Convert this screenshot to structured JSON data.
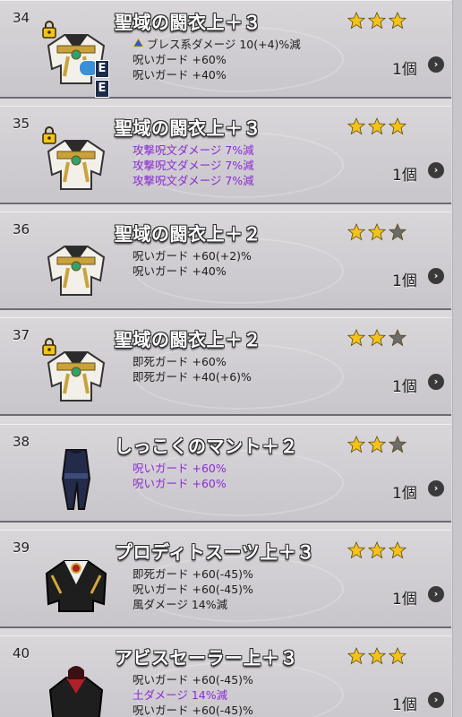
{
  "colors": {
    "gold_star": "#f5c21a",
    "gray_star": "#6c6c6c",
    "purple": "#8a2bd4"
  },
  "items": [
    {
      "num": "34",
      "name": "聖域の闘衣上＋３",
      "stars": 3,
      "locked": true,
      "equipped": true,
      "icon": "holy-robe-icon",
      "lines": [
        {
          "pre": "breath-icon",
          "text": "ブレス系ダメージ 10(+4)%減",
          "purple": false
        },
        {
          "text": "呪いガード +60%",
          "purple": false
        },
        {
          "text": "呪いガード +40%",
          "purple": false
        }
      ],
      "count": "1個"
    },
    {
      "num": "35",
      "name": "聖域の闘衣上＋３",
      "stars": 3,
      "locked": true,
      "equipped": false,
      "icon": "holy-robe-icon",
      "lines": [
        {
          "text": "攻撃呪文ダメージ 7%減",
          "purple": true
        },
        {
          "text": "攻撃呪文ダメージ 7%減",
          "purple": true
        },
        {
          "text": "攻撃呪文ダメージ 7%減",
          "purple": true
        }
      ],
      "count": "1個"
    },
    {
      "num": "36",
      "name": "聖域の闘衣上＋２",
      "stars": 2,
      "locked": false,
      "equipped": false,
      "icon": "holy-robe-icon",
      "lines": [
        {
          "text": "呪いガード +60(+2)%",
          "purple": false
        },
        {
          "text": "呪いガード +40%",
          "purple": false
        }
      ],
      "count": "1個"
    },
    {
      "num": "37",
      "name": "聖域の闘衣上＋２",
      "stars": 2,
      "locked": true,
      "equipped": false,
      "icon": "holy-robe-icon",
      "lines": [
        {
          "text": "即死ガード +60%",
          "purple": false
        },
        {
          "text": "即死ガード +40(+6)%",
          "purple": false
        }
      ],
      "count": "1個"
    },
    {
      "num": "38",
      "name": "しっこくのマント＋２",
      "stars": 2,
      "locked": false,
      "equipped": false,
      "icon": "dark-cloak-icon",
      "lines": [
        {
          "text": "呪いガード +60%",
          "purple": true
        },
        {
          "text": "呪いガード +60%",
          "purple": true
        }
      ],
      "count": "1個"
    },
    {
      "num": "39",
      "name": "プロディトスーツ上＋３",
      "stars": 3,
      "locked": false,
      "equipped": false,
      "icon": "black-suit-icon",
      "lines": [
        {
          "text": "即死ガード +60(-45)%",
          "purple": false
        },
        {
          "text": "呪いガード +60(-45)%",
          "purple": false
        },
        {
          "text": "風ダメージ 14%減",
          "purple": false
        }
      ],
      "count": "1個"
    },
    {
      "num": "40",
      "name": "アビスセーラー上＋３",
      "stars": 3,
      "locked": false,
      "equipped": false,
      "icon": "abyss-sailor-icon",
      "lines": [
        {
          "text": "呪いガード +60(-45)%",
          "purple": false
        },
        {
          "text": "土ダメージ 14%減",
          "purple": true
        },
        {
          "text": "呪いガード +60(-45)%",
          "purple": false
        }
      ],
      "count": "1個"
    }
  ]
}
